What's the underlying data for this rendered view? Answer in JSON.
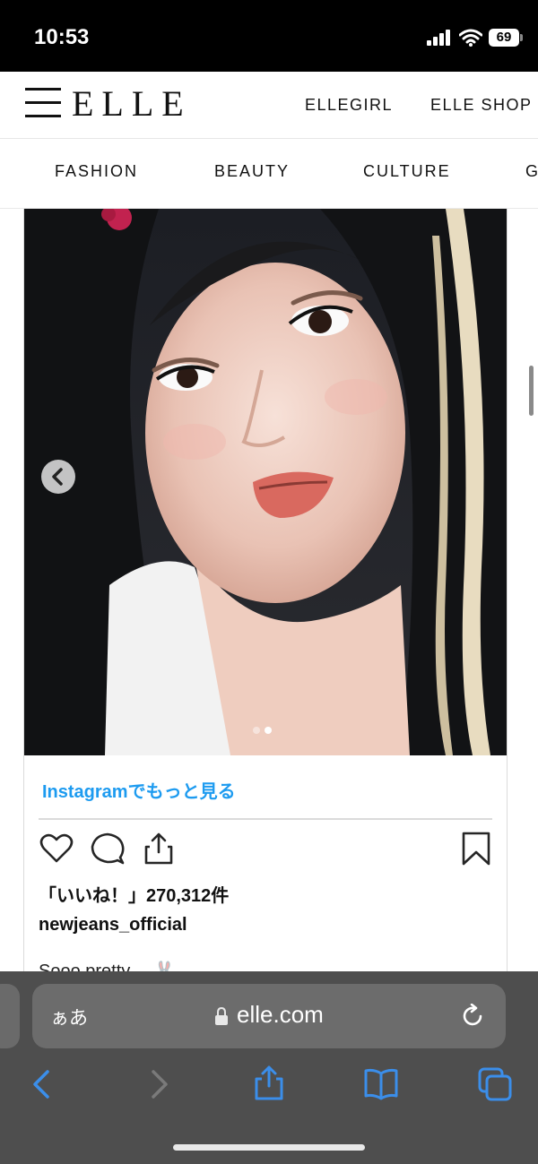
{
  "status_bar": {
    "time": "10:53",
    "battery": "69"
  },
  "site": {
    "logo": "ELLE",
    "top_links": [
      "ELLEGIRL",
      "ELLE SHOP"
    ],
    "categories": [
      "FASHION",
      "BEAUTY",
      "CULTURE",
      "G"
    ]
  },
  "instagram": {
    "view_more": "Instagramでもっと見る",
    "likes": "「いいね！」270,312件",
    "username": "newjeans_official",
    "caption": "Sooo pretty… 🐰",
    "carousel_total": 2,
    "carousel_active": 2
  },
  "safari": {
    "aa_label": "ぁあ",
    "url": "elle.com"
  },
  "colors": {
    "link_blue": "#1d9bf0",
    "ios_blue": "#2f8cf2",
    "toolbar_bg": "#4e4e4e"
  }
}
